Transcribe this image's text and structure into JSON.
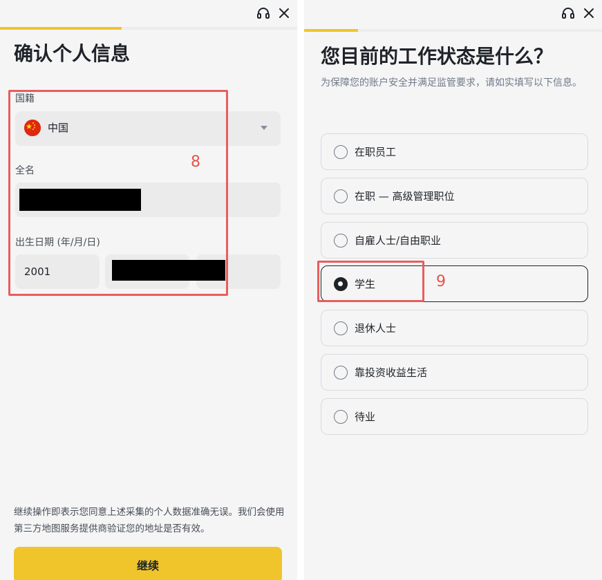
{
  "left": {
    "progress": 0.41,
    "title": "确认个人信息",
    "nationality": {
      "label": "国籍",
      "value": "中国",
      "flag": "china-flag-icon"
    },
    "full_name": {
      "label": "全名",
      "value": ""
    },
    "birth_date": {
      "label": "出生日期 (年/月/日)",
      "year": "2001",
      "month": "",
      "day": ""
    },
    "annotation": "8",
    "disclaimer": "继续操作即表示您同意上述采集的个人数据准确无误。我们会使用第三方地图服务提供商验证您的地址是否有效。",
    "continue_label": "继续"
  },
  "right": {
    "progress": 0.18,
    "title": "您目前的工作状态是什么？",
    "subtitle": "为保障您的账户安全并满足监管要求，请如实填写以下信息。",
    "options": [
      {
        "label": "在职员工",
        "selected": false
      },
      {
        "label": "在职 — 高级管理职位",
        "selected": false
      },
      {
        "label": "自雇人士/自由职业",
        "selected": false
      },
      {
        "label": "学生",
        "selected": true
      },
      {
        "label": "退休人士",
        "selected": false
      },
      {
        "label": "靠投资收益生活",
        "selected": false
      },
      {
        "label": "待业",
        "selected": false
      }
    ],
    "annotation": "9"
  },
  "icons": {
    "support": "headset-icon",
    "close": "close-icon"
  },
  "colors": {
    "accent": "#f0c52b",
    "annotation": "#e5534b",
    "text": "#1e2329"
  }
}
